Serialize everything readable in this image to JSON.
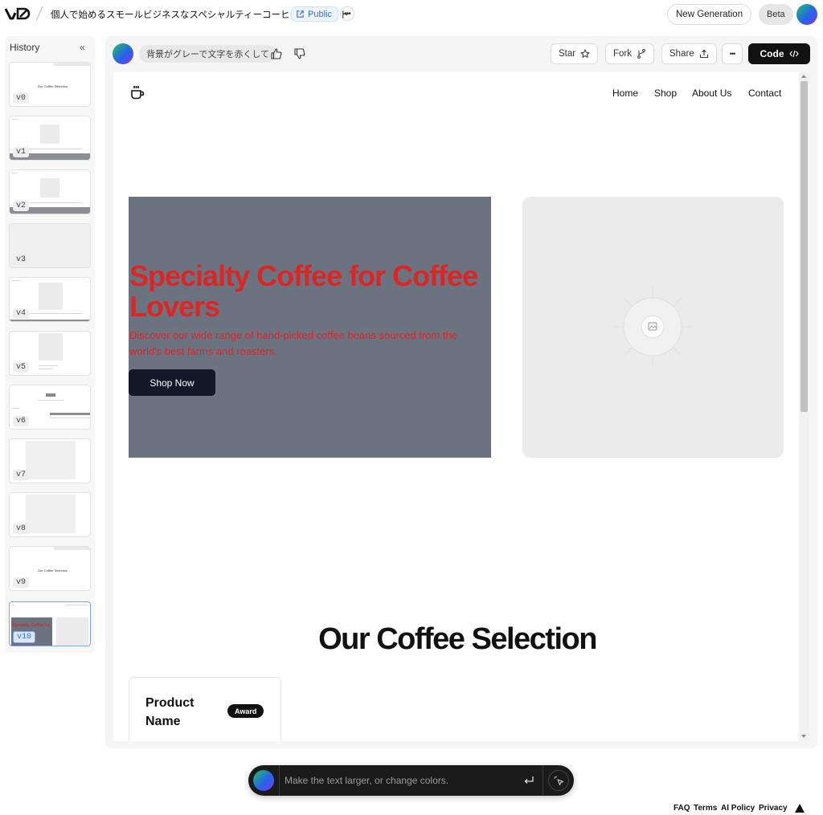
{
  "topbar": {
    "project_title": "個人で始めるスモールビジネスなスペシャルティーコーヒーのECサイト",
    "visibility_label": "Public",
    "new_generation_label": "New Generation",
    "beta_label": "Beta"
  },
  "history": {
    "title": "History",
    "versions": [
      "v0",
      "v1",
      "v2",
      "v3",
      "v4",
      "v5",
      "v6",
      "v7",
      "v8",
      "v9",
      "v10"
    ],
    "active_version": "v10",
    "thumb_texts": {
      "v0": "Our Coffee Selection",
      "v9": "Our Coffee Selection",
      "v10": "Specialty Coffee for"
    }
  },
  "chat": {
    "prompt": "背景がグレーで文字を赤くして"
  },
  "actions": {
    "star_label": "Star",
    "fork_label": "Fork",
    "share_label": "Share",
    "code_label": "Code"
  },
  "site": {
    "nav": [
      "Home",
      "Shop",
      "About Us",
      "Contact"
    ],
    "hero_title": "Specialty Coffee for Coffee Lovers",
    "hero_subtitle": "Discover our wide range of hand-picked coffee beans sourced from the world's best farms and roasters.",
    "cta_label": "Shop Now",
    "section_title": "Our Coffee Selection",
    "product_name": "Product Name",
    "product_badge": "Award"
  },
  "prompt_bar": {
    "placeholder": "Make the text larger, or change colors."
  },
  "footer": {
    "links": [
      "FAQ",
      "Terms",
      "AI Policy",
      "Privacy"
    ]
  },
  "colors": {
    "hero_bg": "#6b7280",
    "hero_text": "#dc2626",
    "accent_blue": "#2d6fe0",
    "cta_bg": "#111827"
  }
}
